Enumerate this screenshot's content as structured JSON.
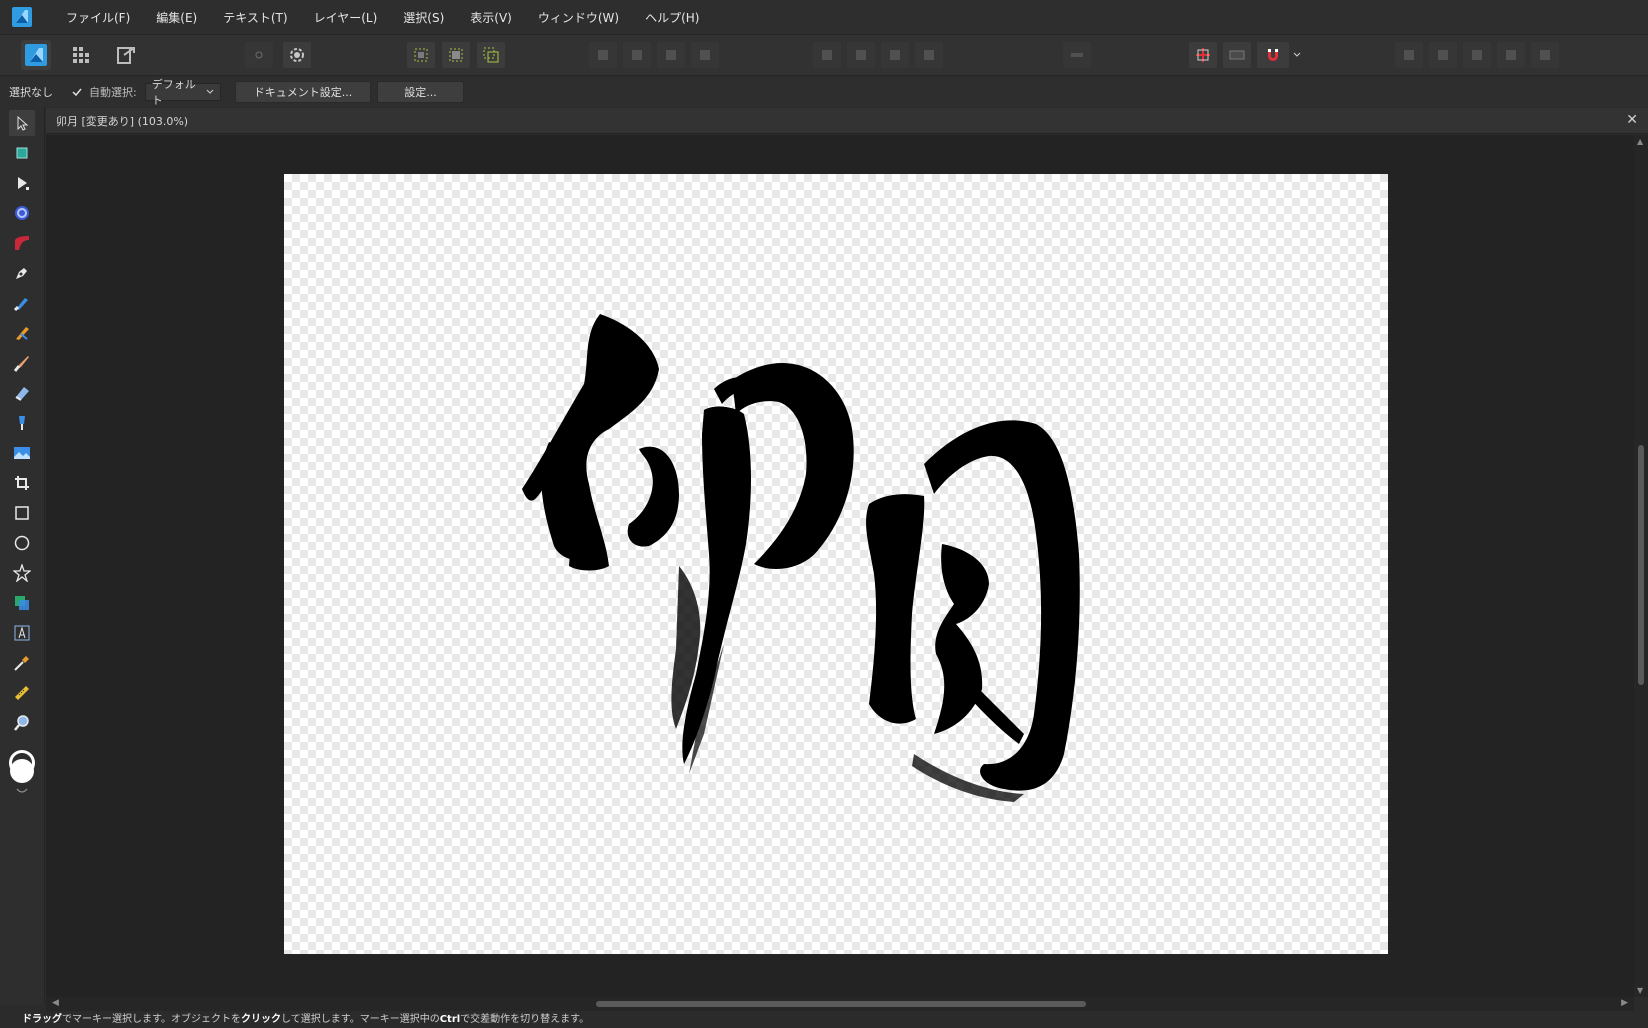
{
  "menubar": {
    "items": [
      "ファイル(F)",
      "編集(E)",
      "テキスト(T)",
      "レイヤー(L)",
      "選択(S)",
      "表示(V)",
      "ウィンドウ(W)",
      "ヘルプ(H)"
    ]
  },
  "contextbar": {
    "selection_text": "選択なし",
    "auto_select_label": "自動選択:",
    "auto_select_value": "デフォルト",
    "document_setup_label": "ドキュメント設定...",
    "settings_label": "設定..."
  },
  "document": {
    "tab_title": "卯月 [変更あり] (103.0%)",
    "artwork_text": "卯月"
  },
  "status": {
    "drag": "ドラッグ",
    "t1": "でマーキー選択します。オブジェクトを",
    "click": "クリック",
    "t2": "して選択します。マーキー選択中の",
    "ctrl": "Ctrl",
    "t3": "で交差動作を切り替えます。"
  },
  "colors": {
    "accent": "#2f9be0",
    "snapping_magnet": "#e0303a",
    "canvas_bg": "#232323"
  },
  "icons": {
    "tools": [
      "move-icon",
      "artboard-icon",
      "node-icon",
      "corner-icon",
      "pencil-icon",
      "pen-icon",
      "vector-brush-icon",
      "fill-icon",
      "pixel-brush-icon",
      "eraser-icon",
      "transparency-icon",
      "place-image-icon",
      "crop-icon",
      "rectangle-icon",
      "ellipse-icon",
      "star-icon",
      "shape-builder-icon",
      "text-icon",
      "color-picker-icon",
      "measure-icon",
      "zoom-icon",
      "color-well-icon"
    ]
  }
}
